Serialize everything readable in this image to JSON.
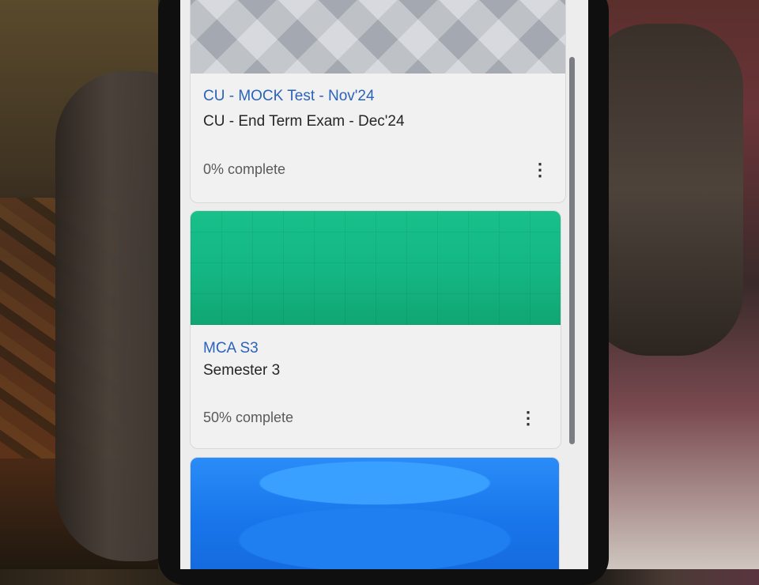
{
  "courses": [
    {
      "title": "CU - MOCK Test - Nov'24",
      "subtitle": "CU - End Term Exam - Dec'24",
      "progress_text": "0% complete",
      "progress_value": 0,
      "banner_color": "#b8bcc4",
      "menu_icon": "more-vertical-icon",
      "menu_glyph": "⋮"
    },
    {
      "title": "MCA S3",
      "subtitle": "Semester 3",
      "progress_text": "50% complete",
      "progress_value": 50,
      "banner_color": "#14b783",
      "menu_icon": "more-vertical-icon",
      "menu_glyph": "⋮"
    },
    {
      "banner_color": "#1876ea"
    }
  ],
  "colors": {
    "link": "#2a63b8",
    "text": "#262626",
    "muted": "#5a5a5a",
    "card_bg": "#f1f1f1"
  }
}
